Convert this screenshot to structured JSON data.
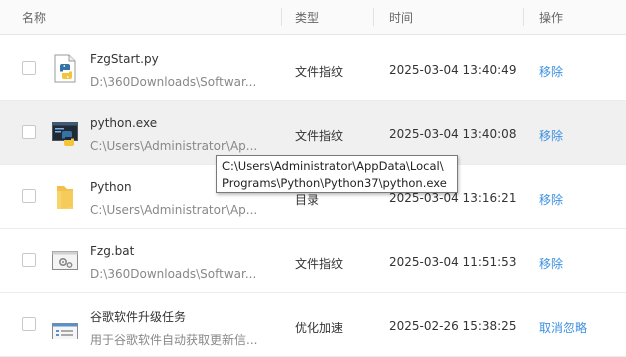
{
  "header": {
    "col_name": "名称",
    "col_type": "类型",
    "col_time": "时间",
    "col_action": "操作"
  },
  "rows": [
    {
      "name": "FzgStart.py",
      "path": "D:\\360Downloads\\Softwar...",
      "type": "文件指纹",
      "time": "2025-03-04 13:40:49",
      "action": "移除",
      "icon": "python-file-icon"
    },
    {
      "name": "python.exe",
      "path": "C:\\Users\\Administrator\\Ap...",
      "type": "文件指纹",
      "time": "2025-03-04 13:40:08",
      "action": "移除",
      "icon": "python-exe-icon"
    },
    {
      "name": "Python",
      "path": "C:\\Users\\Administrator\\Ap...",
      "type": "目录",
      "time": "2025-03-04 13:16:21",
      "action": "移除",
      "icon": "folder-icon"
    },
    {
      "name": "Fzg.bat",
      "path": "D:\\360Downloads\\Softwar...",
      "type": "文件指纹",
      "time": "2025-03-04 11:51:53",
      "action": "移除",
      "icon": "batch-file-icon"
    },
    {
      "name": "谷歌软件升级任务",
      "path": "用于谷歌软件自动获取更新信...",
      "type": "优化加速",
      "time": "2025-02-26 15:38:25",
      "action": "取消忽略",
      "icon": "task-icon"
    }
  ],
  "tooltip": {
    "line1": "C:\\Users\\Administrator\\AppData\\Local\\",
    "line2": "Programs\\Python\\Python37\\python.exe"
  },
  "colors": {
    "accent": "#3b8fe0",
    "hover_row": "#f0f0f0",
    "header_bg": "#fafafa"
  }
}
